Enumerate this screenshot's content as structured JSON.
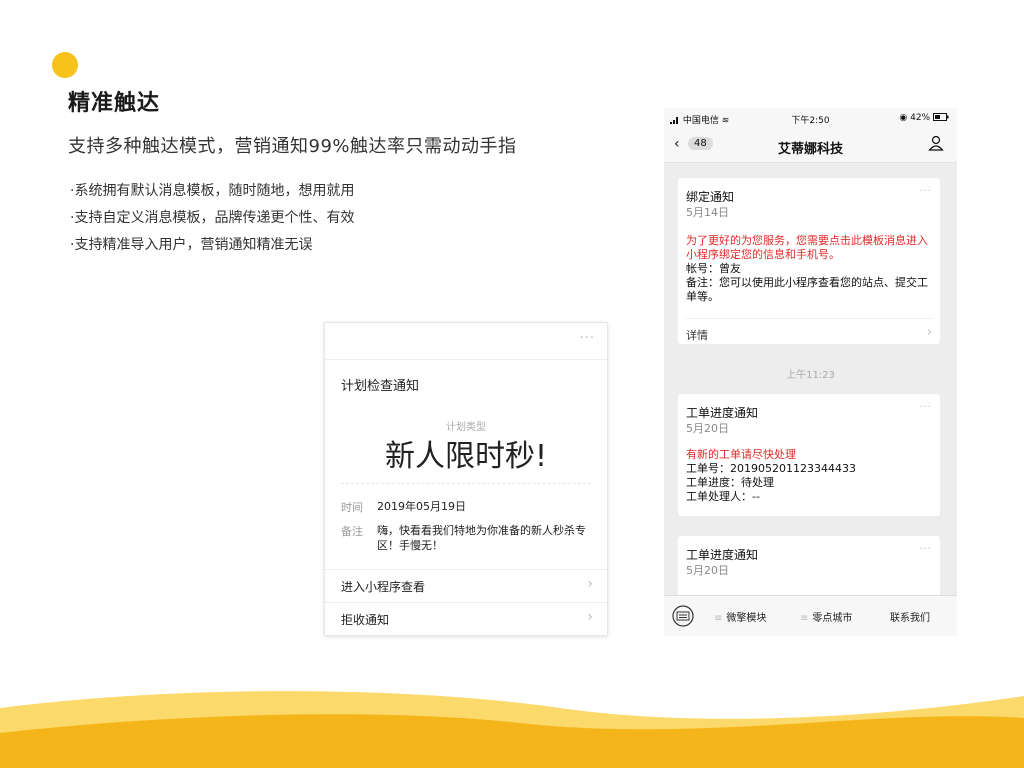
{
  "header": {
    "title": "精准触达",
    "subtitle": "支持多种触达模式，营销通知99%触达率只需动动手指",
    "bullets": [
      "·系统拥有默认消息模板，随时随地，想用就用",
      "·支持自定义消息模板，品牌传递更个性、有效",
      "·支持精准导入用户，营销通知精准无误"
    ]
  },
  "card1": {
    "more": "···",
    "title": "计划检查通知",
    "type_label": "计划类型",
    "type_value": "新人限时秒!",
    "time_label": "时间",
    "time_value": "2019年05月19日",
    "note_label": "备注",
    "note_value": "嗨，快看看我们特地为你准备的新人秒杀专区！手慢无！",
    "link1": "进入小程序查看",
    "link2": "拒收通知",
    "chevron": "›"
  },
  "phone": {
    "status": {
      "left": "中国电信",
      "time": "下午2:50",
      "battery": "42%"
    },
    "nav": {
      "back": "‹",
      "unread": "48",
      "title": "艾蒂娜科技"
    },
    "msg1": {
      "title": "绑定通知",
      "date": "5月14日",
      "more": "···",
      "red_text": "为了更好的为您服务，您需要点击此模板消息进入小程序绑定您的信息和手机号。",
      "line1": "帐号：曾友",
      "line2": "备注：您可以使用此小程序查看您的站点、提交工单等。",
      "detail": "详情",
      "chevron": "›"
    },
    "timestamp": "上午11:23",
    "msg2": {
      "title": "工单进度通知",
      "date": "5月20日",
      "more": "···",
      "red_text": "有新的工单请尽快处理",
      "line1": "工单号：201905201123344433",
      "line2": "工单进度：待处理",
      "line3": "工单处理人：--"
    },
    "msg3": {
      "title": "工单进度通知",
      "date": "5月20日",
      "more": "···"
    },
    "bottom_menu": [
      "微擎模块",
      "零点城市",
      "联系我们"
    ],
    "dots": "≡"
  },
  "colors": {
    "accent_yellow": "#f6c21b",
    "wave_light": "#fbd96a",
    "wave_dark": "#f4b51a",
    "alert_red": "#e02a2a"
  }
}
